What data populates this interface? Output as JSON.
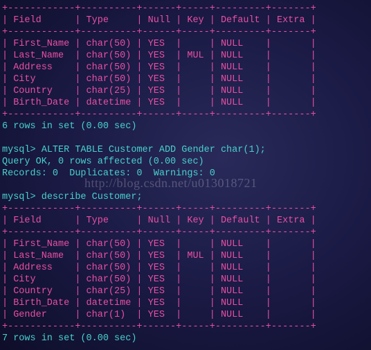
{
  "watermark": "http://blog.csdn.net/u013018721",
  "table1": {
    "border_top": "+------------+----------+------+-----+---------+-------+",
    "header": "| Field      | Type     | Null | Key | Default | Extra |",
    "border_mid": "+------------+----------+------+-----+---------+-------+",
    "rows": [
      "| First_Name | char(50) | YES  |     | NULL    |       |",
      "| Last_Name  | char(50) | YES  | MUL | NULL    |       |",
      "| Address    | char(50) | YES  |     | NULL    |       |",
      "| City       | char(50) | YES  |     | NULL    |       |",
      "| Country    | char(25) | YES  |     | NULL    |       |",
      "| Birth_Date | datetime | YES  |     | NULL    |       |"
    ],
    "border_bot": "+------------+----------+------+-----+---------+-------+",
    "summary": "6 rows in set (0.00 sec)"
  },
  "cmd1": {
    "prompt": "mysql> ",
    "stmt": "ALTER TABLE Customer ADD Gender char(1);",
    "result1": "Query OK, 0 rows affected (0.00 sec)",
    "result2": "Records: 0  Duplicates: 0  Warnings: 0"
  },
  "cmd2": {
    "prompt": "mysql> ",
    "stmt": "describe Customer;"
  },
  "table2": {
    "border_top": "+------------+----------+------+-----+---------+-------+",
    "header": "| Field      | Type     | Null | Key | Default | Extra |",
    "border_mid": "+------------+----------+------+-----+---------+-------+",
    "rows": [
      "| First_Name | char(50) | YES  |     | NULL    |       |",
      "| Last_Name  | char(50) | YES  | MUL | NULL    |       |",
      "| Address    | char(50) | YES  |     | NULL    |       |",
      "| City       | char(50) | YES  |     | NULL    |       |",
      "| Country    | char(25) | YES  |     | NULL    |       |",
      "| Birth_Date | datetime | YES  |     | NULL    |       |",
      "| Gender     | char(1)  | YES  |     | NULL    |       |"
    ],
    "border_bot": "+------------+----------+------+-----+---------+-------+",
    "summary": "7 rows in set (0.00 sec)"
  }
}
